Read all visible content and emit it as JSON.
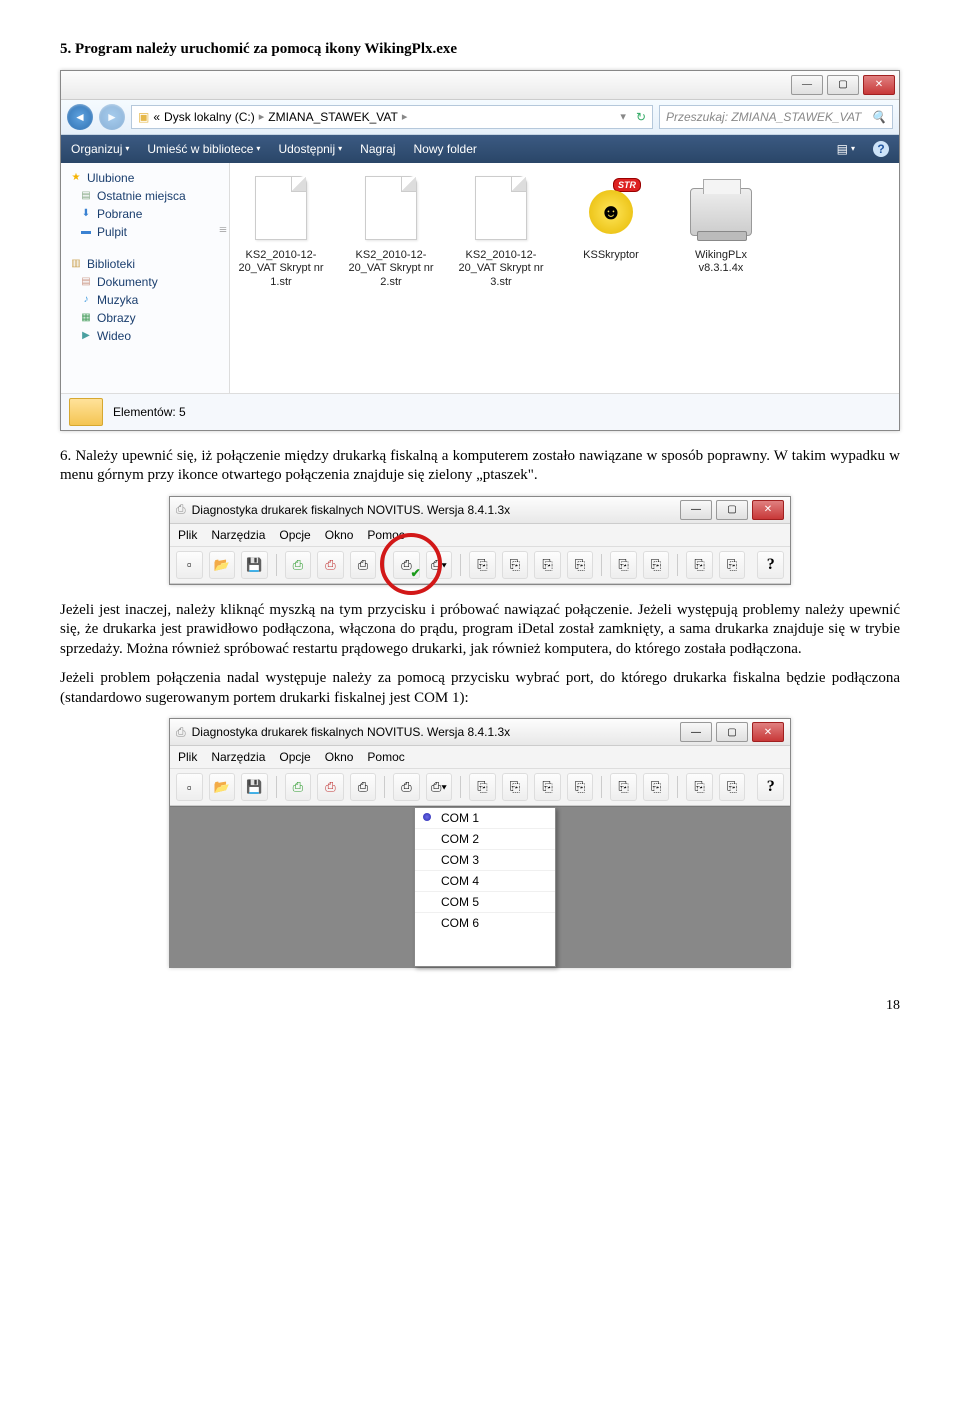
{
  "step5_heading": "5.  Program należy uruchomić za pomocą ikony WikingPlx.exe",
  "explorer": {
    "breadcrumb_prefix": "«",
    "breadcrumb_drive": "Dysk lokalny (C:)",
    "breadcrumb_folder": "ZMIANA_STAWEK_VAT",
    "search_placeholder": "Przeszukaj: ZMIANA_STAWEK_VAT",
    "toolbar": {
      "organize": "Organizuj",
      "library": "Umieść w bibliotece",
      "share": "Udostępnij",
      "record": "Nagraj",
      "newfolder": "Nowy folder"
    },
    "sidebar": {
      "favorites": "Ulubione",
      "recent": "Ostatnie miejsca",
      "downloads": "Pobrane",
      "desktop": "Pulpit",
      "libraries": "Biblioteki",
      "documents": "Dokumenty",
      "music": "Muzyka",
      "pictures": "Obrazy",
      "videos": "Wideo"
    },
    "files": {
      "f1": "KS2_2010-12-20_VAT Skrypt nr 1.str",
      "f2": "KS2_2010-12-20_VAT Skrypt nr 2.str",
      "f3": "KS2_2010-12-20_VAT Skrypt nr 3.str",
      "f4": "KSSkryptor",
      "f5": "WikingPLx v8.3.1.4x",
      "str_badge": "STR"
    },
    "status": "Elementów: 5"
  },
  "step6_text": "6.  Należy upewnić się, iż połączenie między drukarką fiskalną a komputerem zostało nawiązane w sposób poprawny. W takim wypadku w menu górnym przy ikonce otwartego połączenia znajduje się zielony „ptaszek\".",
  "diag": {
    "title": "Diagnostyka drukarek fiskalnych NOVITUS. Wersja 8.4.1.3x",
    "menu": {
      "file": "Plik",
      "tools": "Narzędzia",
      "options": "Opcje",
      "window": "Okno",
      "help": "Pomoc"
    }
  },
  "middle_para": "Jeżeli jest inaczej, należy kliknąć myszką na tym przycisku i próbować nawiązać połączenie. Jeżeli występują problemy należy upewnić się, że drukarka jest prawidłowo podłączona, włączona do prądu, program iDetal został zamknięty, a sama drukarka znajduje się w trybie sprzedaży. Można również spróbować restartu prądowego drukarki, jak również komputera, do którego została podłączona.",
  "last_para": "Jeżeli problem połączenia nadal występuje należy za pomocą przycisku wybrać port, do którego drukarka fiskalna będzie podłączona (standardowo sugerowanym portem drukarki fiskalnej jest COM 1):",
  "com_options": {
    "c1": "COM 1",
    "c2": "COM 2",
    "c3": "COM 3",
    "c4": "COM 4",
    "c5": "COM 5",
    "c6": "COM 6"
  },
  "page_number": "18"
}
